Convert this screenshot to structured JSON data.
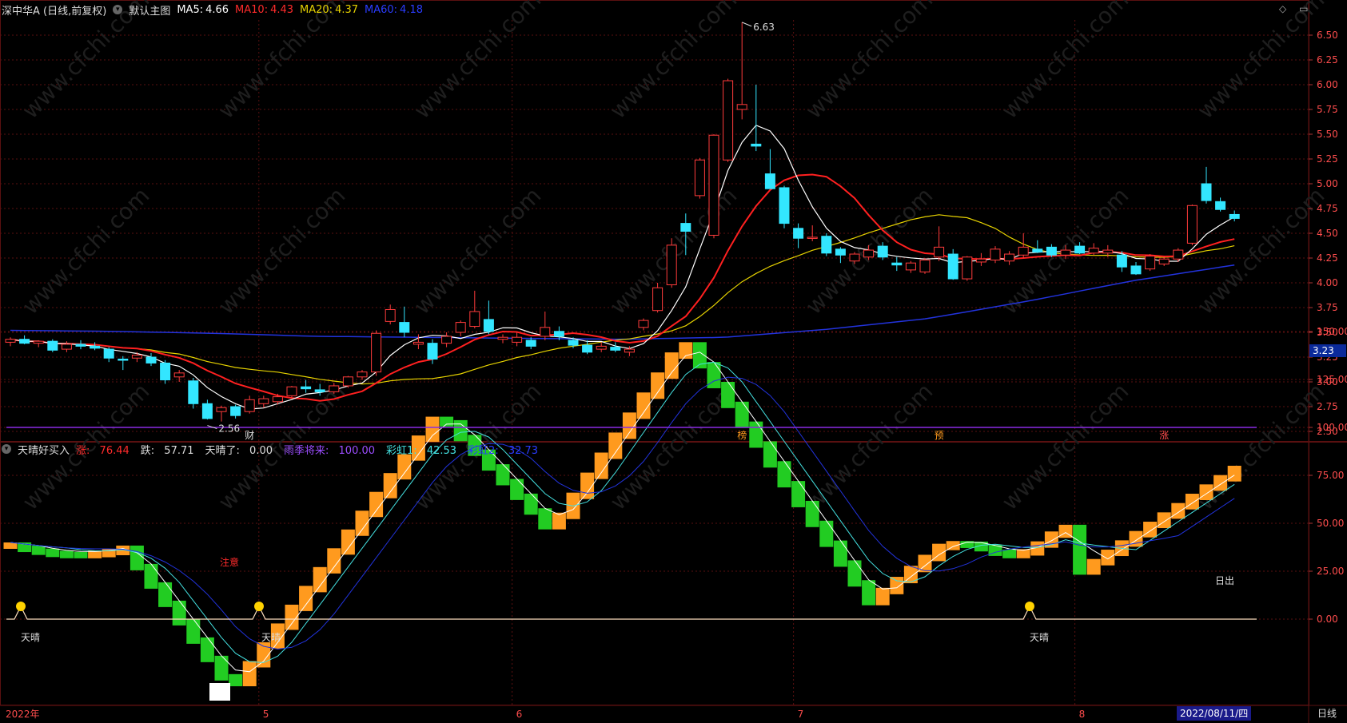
{
  "header": {
    "stock": "深中华A (日线,前复权)",
    "main_indicator": "默认主图",
    "ma5_label": "MA5:",
    "ma5": "4.66",
    "ma10_label": "MA10:",
    "ma10": "4.43",
    "ma20_label": "MA20:",
    "ma20": "4.37",
    "ma60_label": "MA60:",
    "ma60": "4.18"
  },
  "sub_header": {
    "indicator": "天晴好买入",
    "zhang_label": "涨:",
    "zhang": "76.44",
    "die_label": "跌:",
    "die": "57.71",
    "tianqing_label": "天晴了:",
    "tianqing": "0.00",
    "rain_label": "雨季将来:",
    "rain": "100.00",
    "rb1_label": "彩虹1:",
    "rb1": "42.53",
    "rb2_label": "彩虹2:",
    "rb2": "32.73"
  },
  "price_axis": [
    "6.50",
    "6.25",
    "6.00",
    "5.75",
    "5.50",
    "5.25",
    "5.00",
    "4.75",
    "4.50",
    "4.25",
    "4.00",
    "3.75",
    "3.50",
    "3.25",
    "3.00",
    "2.75",
    "2.50"
  ],
  "osc_axis": [
    "150.00",
    "125.00",
    "100.00",
    "75.00",
    "50.00",
    "25.00",
    "0.00"
  ],
  "current_price": "3.23",
  "high_label": "6.63",
  "low_label": "2.56",
  "event_markers": [
    "财",
    "榜",
    "预",
    "涨"
  ],
  "annotations": {
    "attention": "注意",
    "sunny": "天晴",
    "sunrise": "日出"
  },
  "time_axis": [
    "2022年",
    "5",
    "6",
    "7",
    "8"
  ],
  "selected_date": "2022/08/11/四",
  "period": "日线",
  "watermark": "www.cfchi.com",
  "colors": {
    "up": "#ff3b3b",
    "down": "#33e6ff",
    "ma5": "#ffffff",
    "ma10": "#ff2020",
    "ma20": "#e6d200",
    "ma60": "#2233dd",
    "orange": "#ff9a1e",
    "green": "#22cc22",
    "purple": "#8a2be2",
    "grid": "#5a1010"
  },
  "chart_data": {
    "type": "candlestick",
    "candles": [
      [
        3.4,
        3.45,
        3.36,
        3.43
      ],
      [
        3.43,
        3.47,
        3.38,
        3.39
      ],
      [
        3.39,
        3.42,
        3.35,
        3.41
      ],
      [
        3.41,
        3.43,
        3.3,
        3.32
      ],
      [
        3.33,
        3.41,
        3.3,
        3.38
      ],
      [
        3.38,
        3.42,
        3.33,
        3.36
      ],
      [
        3.36,
        3.4,
        3.32,
        3.34
      ],
      [
        3.33,
        3.35,
        3.2,
        3.24
      ],
      [
        3.23,
        3.26,
        3.12,
        3.22
      ],
      [
        3.24,
        3.3,
        3.2,
        3.27
      ],
      [
        3.25,
        3.29,
        3.16,
        3.19
      ],
      [
        3.19,
        3.22,
        2.98,
        3.02
      ],
      [
        3.05,
        3.12,
        3.0,
        3.09
      ],
      [
        3.01,
        3.04,
        2.73,
        2.78
      ],
      [
        2.78,
        2.82,
        2.62,
        2.63
      ],
      [
        2.7,
        2.76,
        2.6,
        2.74
      ],
      [
        2.75,
        2.77,
        2.63,
        2.66
      ],
      [
        2.7,
        2.86,
        2.68,
        2.82
      ],
      [
        2.78,
        2.86,
        2.74,
        2.83
      ],
      [
        2.8,
        2.88,
        2.77,
        2.85
      ],
      [
        2.86,
        2.96,
        2.84,
        2.95
      ],
      [
        2.95,
        3.02,
        2.89,
        2.93
      ],
      [
        2.92,
        2.98,
        2.86,
        2.9
      ],
      [
        2.9,
        2.99,
        2.88,
        2.96
      ],
      [
        2.96,
        3.06,
        2.94,
        3.05
      ],
      [
        3.05,
        3.12,
        3.02,
        3.1
      ],
      [
        3.1,
        3.52,
        3.06,
        3.49
      ],
      [
        3.61,
        3.78,
        3.58,
        3.73
      ],
      [
        3.6,
        3.76,
        3.45,
        3.5
      ],
      [
        3.38,
        3.48,
        3.33,
        3.4
      ],
      [
        3.39,
        3.43,
        3.18,
        3.23
      ],
      [
        3.39,
        3.5,
        3.35,
        3.46
      ],
      [
        3.5,
        3.62,
        3.46,
        3.6
      ],
      [
        3.56,
        3.92,
        3.54,
        3.71
      ],
      [
        3.63,
        3.82,
        3.48,
        3.51
      ],
      [
        3.43,
        3.48,
        3.39,
        3.45
      ],
      [
        3.4,
        3.5,
        3.36,
        3.45
      ],
      [
        3.42,
        3.45,
        3.33,
        3.36
      ],
      [
        3.46,
        3.71,
        3.42,
        3.55
      ],
      [
        3.51,
        3.56,
        3.42,
        3.46
      ],
      [
        3.42,
        3.45,
        3.34,
        3.37
      ],
      [
        3.37,
        3.42,
        3.28,
        3.3
      ],
      [
        3.33,
        3.4,
        3.3,
        3.36
      ],
      [
        3.35,
        3.4,
        3.3,
        3.32
      ],
      [
        3.3,
        3.36,
        3.26,
        3.33
      ],
      [
        3.55,
        3.64,
        3.52,
        3.62
      ],
      [
        3.72,
        4.0,
        3.7,
        3.95
      ],
      [
        3.98,
        4.45,
        3.95,
        4.38
      ],
      [
        4.6,
        4.7,
        4.28,
        4.52
      ],
      [
        4.88,
        5.26,
        4.85,
        5.24
      ],
      [
        4.48,
        5.5,
        4.45,
        5.49
      ],
      [
        5.24,
        6.06,
        5.22,
        6.04
      ],
      [
        5.75,
        6.63,
        5.65,
        5.8
      ],
      [
        5.4,
        6.0,
        5.33,
        5.38
      ],
      [
        5.1,
        5.35,
        4.98,
        4.95
      ],
      [
        4.96,
        4.98,
        4.55,
        4.6
      ],
      [
        4.55,
        4.6,
        4.35,
        4.45
      ],
      [
        4.45,
        4.58,
        4.42,
        4.46
      ],
      [
        4.47,
        4.5,
        4.27,
        4.3
      ],
      [
        4.34,
        4.36,
        4.2,
        4.28
      ],
      [
        4.22,
        4.31,
        4.19,
        4.29
      ],
      [
        4.26,
        4.38,
        4.23,
        4.33
      ],
      [
        4.37,
        4.41,
        4.23,
        4.26
      ],
      [
        4.2,
        4.26,
        4.12,
        4.18
      ],
      [
        4.13,
        4.22,
        4.1,
        4.2
      ],
      [
        4.11,
        4.25,
        4.09,
        4.23
      ],
      [
        4.26,
        4.57,
        4.22,
        4.36
      ],
      [
        4.29,
        4.34,
        4.03,
        4.04
      ],
      [
        4.04,
        4.27,
        4.02,
        4.26
      ],
      [
        4.21,
        4.3,
        4.17,
        4.24
      ],
      [
        4.23,
        4.37,
        4.2,
        4.34
      ],
      [
        4.22,
        4.32,
        4.18,
        4.29
      ],
      [
        4.28,
        4.5,
        4.25,
        4.36
      ],
      [
        4.34,
        4.43,
        4.3,
        4.31
      ],
      [
        4.36,
        4.39,
        4.26,
        4.28
      ],
      [
        4.28,
        4.38,
        4.24,
        4.33
      ],
      [
        4.37,
        4.41,
        4.29,
        4.3
      ],
      [
        4.3,
        4.4,
        4.28,
        4.35
      ],
      [
        4.3,
        4.38,
        4.26,
        4.33
      ],
      [
        4.28,
        4.32,
        4.11,
        4.16
      ],
      [
        4.17,
        4.21,
        4.08,
        4.09
      ],
      [
        4.14,
        4.29,
        4.12,
        4.27
      ],
      [
        4.19,
        4.27,
        4.17,
        4.24
      ],
      [
        4.24,
        4.35,
        4.21,
        4.33
      ],
      [
        4.4,
        4.79,
        4.38,
        4.78
      ],
      [
        5.0,
        5.17,
        4.8,
        4.83
      ],
      [
        4.82,
        4.86,
        4.72,
        4.74
      ],
      [
        4.69,
        4.73,
        4.62,
        4.65
      ]
    ],
    "ma60": [
      3.52,
      3.51,
      3.49,
      3.46,
      3.45,
      3.44,
      3.43,
      3.45,
      3.53,
      3.64,
      3.82,
      4.02,
      4.18
    ],
    "oscillator_axis": [
      0,
      25,
      50,
      75,
      100,
      125,
      150
    ]
  }
}
